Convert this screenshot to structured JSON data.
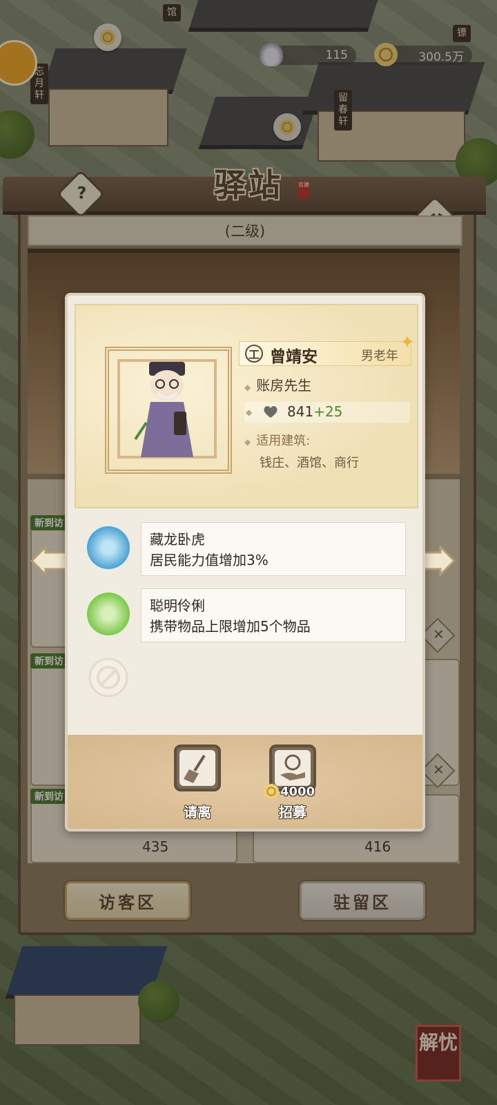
{
  "resources": {
    "silver": "115",
    "coins": "300.5万"
  },
  "town_signs": [
    "忘月轩",
    "留春轩",
    "馆",
    "镖"
  ],
  "station": {
    "title": "驿站",
    "seal": "官建",
    "level": "(二级)"
  },
  "list_bg": {
    "new_tag": "新到访",
    "powers": [
      "435",
      "416"
    ]
  },
  "zones": {
    "visitor": "访客区",
    "stay": "驻留区"
  },
  "visitor": {
    "name": "曾靖安",
    "rank_icon": "工",
    "gender_age": "男老年",
    "profession": "账房先生",
    "power": "841",
    "power_bonus": "+25",
    "buildings_label": "适用建筑:",
    "buildings": "钱庄、酒馆、商行"
  },
  "skills": [
    {
      "name": "藏龙卧虎",
      "desc": "居民能力值增加3%",
      "color": "#4aa3d6"
    },
    {
      "name": "聪明伶俐",
      "desc": "携带物品上限增加5个物品",
      "color": "#7cc84a"
    }
  ],
  "actions": {
    "dismiss": "请离",
    "recruit": "招募",
    "recruit_cost": "4000"
  },
  "corner_seal": "解忧"
}
